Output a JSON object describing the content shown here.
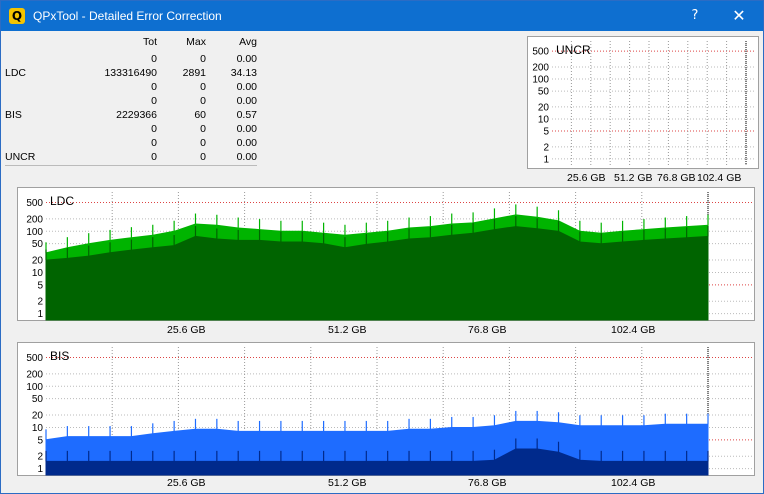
{
  "window": {
    "title": "QPxTool - Detailed Error Correction",
    "help_label": "?",
    "close_label": "✕"
  },
  "stats": {
    "headers": [
      "Tot",
      "Max",
      "Avg"
    ],
    "rows": [
      {
        "label": "",
        "tot": "0",
        "max": "0",
        "avg": "0.00"
      },
      {
        "label": "LDC",
        "tot": "133316490",
        "max": "2891",
        "avg": "34.13"
      },
      {
        "label": "",
        "tot": "0",
        "max": "0",
        "avg": "0.00"
      },
      {
        "label": "",
        "tot": "0",
        "max": "0",
        "avg": "0.00"
      },
      {
        "label": "BIS",
        "tot": "2229366",
        "max": "60",
        "avg": "0.57"
      },
      {
        "label": "",
        "tot": "0",
        "max": "0",
        "avg": "0.00"
      },
      {
        "label": "",
        "tot": "0",
        "max": "0",
        "avg": "0.00"
      },
      {
        "label": "UNCR",
        "tot": "0",
        "max": "0",
        "avg": "0.00"
      }
    ]
  },
  "chart_data": [
    {
      "name": "UNCR",
      "type": "area",
      "title": "UNCR",
      "y_scale": "log",
      "y_ticks": [
        500,
        200,
        100,
        50,
        20,
        10,
        5,
        2,
        1
      ],
      "y_tick_labels": [
        "500",
        "200",
        "100",
        "50",
        "20",
        "10",
        "5",
        "2",
        "1"
      ],
      "x_tick_labels": [
        "25.6 GB",
        "51.2 GB",
        "76.8 GB",
        "102.4 GB"
      ],
      "series": [
        {
          "values": []
        }
      ]
    },
    {
      "name": "LDC",
      "type": "area",
      "title": "LDC",
      "y_scale": "log",
      "y_ticks": [
        500,
        200,
        100,
        50,
        20,
        10,
        5,
        2,
        1
      ],
      "y_tick_labels": [
        "500",
        "200",
        "100",
        "50",
        "20",
        "10",
        "5",
        "2",
        "1"
      ],
      "x_tick_labels": [
        "25.6 GB",
        "51.2 GB",
        "76.8 GB",
        "102.4 GB"
      ],
      "x_max": 128,
      "series": [
        {
          "color": "#00b400",
          "x": [
            0,
            4,
            8,
            12,
            16,
            20,
            24,
            28,
            32,
            36,
            40,
            44,
            48,
            52,
            56,
            60,
            64,
            68,
            72,
            76,
            80,
            84,
            88,
            92,
            96,
            100,
            104,
            108,
            112,
            116,
            120,
            124
          ],
          "values": [
            30,
            40,
            50,
            60,
            70,
            80,
            100,
            150,
            140,
            120,
            110,
            100,
            100,
            90,
            80,
            90,
            100,
            120,
            130,
            150,
            160,
            200,
            250,
            220,
            180,
            100,
            90,
            100,
            110,
            120,
            130,
            140
          ]
        },
        {
          "color": "#006400",
          "x": [
            0,
            4,
            8,
            12,
            16,
            20,
            24,
            28,
            32,
            36,
            40,
            44,
            48,
            52,
            56,
            60,
            64,
            68,
            72,
            76,
            80,
            84,
            88,
            92,
            96,
            100,
            104,
            108,
            112,
            116,
            120,
            124
          ],
          "values": [
            20,
            22,
            25,
            30,
            35,
            40,
            45,
            75,
            65,
            60,
            60,
            55,
            55,
            50,
            40,
            48,
            55,
            65,
            70,
            80,
            90,
            110,
            130,
            115,
            100,
            55,
            50,
            55,
            60,
            65,
            70,
            75
          ]
        }
      ]
    },
    {
      "name": "BIS",
      "type": "area",
      "title": "BIS",
      "y_scale": "log",
      "y_ticks": [
        500,
        200,
        100,
        50,
        20,
        10,
        5,
        2,
        1
      ],
      "y_tick_labels": [
        "500",
        "200",
        "100",
        "50",
        "20",
        "10",
        "5",
        "2",
        "1"
      ],
      "x_tick_labels": [
        "25.6 GB",
        "51.2 GB",
        "76.8 GB",
        "102.4 GB"
      ],
      "x_max": 128,
      "series": [
        {
          "color": "#1e6cff",
          "x": [
            0,
            4,
            8,
            12,
            16,
            20,
            24,
            28,
            32,
            36,
            40,
            44,
            48,
            52,
            56,
            60,
            64,
            68,
            72,
            76,
            80,
            84,
            88,
            92,
            96,
            100,
            104,
            108,
            112,
            116,
            120,
            124
          ],
          "values": [
            5,
            6,
            6,
            6,
            6,
            7,
            8,
            9,
            9,
            8,
            8,
            8,
            8,
            8,
            8,
            8,
            8,
            9,
            9,
            10,
            10,
            11,
            14,
            14,
            13,
            11,
            11,
            11,
            11,
            12,
            12,
            12
          ]
        },
        {
          "color": "#002a8c",
          "x": [
            0,
            4,
            8,
            12,
            16,
            20,
            24,
            28,
            32,
            36,
            40,
            44,
            48,
            52,
            56,
            60,
            64,
            68,
            72,
            76,
            80,
            84,
            88,
            92,
            96,
            100,
            104,
            108,
            112,
            116,
            120,
            124
          ],
          "values": [
            1.5,
            1.5,
            1.5,
            1.5,
            1.5,
            1.5,
            1.5,
            1.5,
            1.5,
            1.5,
            1.5,
            1.5,
            1.5,
            1.5,
            1.5,
            1.5,
            1.5,
            1.5,
            1.5,
            1.5,
            1.5,
            1.6,
            3,
            3,
            2.5,
            1.6,
            1.5,
            1.5,
            1.5,
            1.5,
            1.5,
            1.5
          ]
        }
      ]
    }
  ]
}
